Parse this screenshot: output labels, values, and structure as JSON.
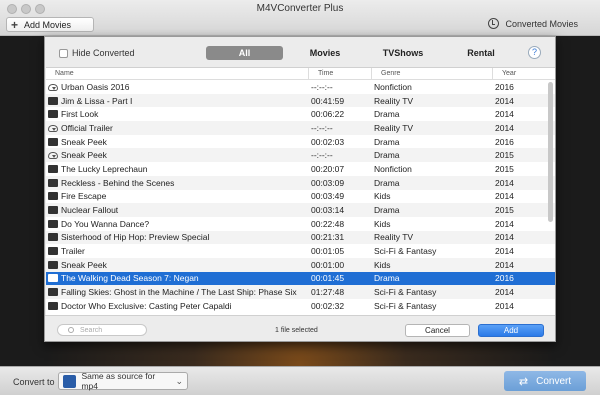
{
  "window": {
    "title": "M4VConverter Plus"
  },
  "toolbar": {
    "add_movies": "Add Movies",
    "converted_movies": "Converted Movies"
  },
  "dialog": {
    "hide_converted": "Hide Converted",
    "hide_converted_checked": false,
    "tabs": [
      {
        "label": "All",
        "active": true
      },
      {
        "label": "Movies",
        "active": false
      },
      {
        "label": "TVShows",
        "active": false
      },
      {
        "label": "Rental",
        "active": false
      }
    ],
    "help": "?",
    "columns": {
      "name": "Name",
      "time": "Time",
      "genre": "Genre",
      "year": "Year"
    },
    "rows": [
      {
        "icon": "cloud-download-icon",
        "name": "Urban Oasis 2016",
        "time": "--:--:--",
        "genre": "Nonfiction",
        "year": "2016"
      },
      {
        "icon": "film-icon",
        "name": "Jim & Lissa - Part I",
        "time": "00:41:59",
        "genre": "Reality TV",
        "year": "2014"
      },
      {
        "icon": "film-icon",
        "name": "First Look",
        "time": "00:06:22",
        "genre": "Drama",
        "year": "2014"
      },
      {
        "icon": "cloud-download-icon",
        "name": "Official Trailer",
        "time": "--:--:--",
        "genre": "Reality TV",
        "year": "2014"
      },
      {
        "icon": "film-icon",
        "name": "Sneak Peek",
        "time": "00:02:03",
        "genre": "Drama",
        "year": "2016"
      },
      {
        "icon": "cloud-download-icon",
        "name": "Sneak Peek",
        "time": "--:--:--",
        "genre": "Drama",
        "year": "2015"
      },
      {
        "icon": "film-icon",
        "name": "The Lucky Leprechaun",
        "time": "00:20:07",
        "genre": "Nonfiction",
        "year": "2015"
      },
      {
        "icon": "film-icon",
        "name": "Reckless - Behind the Scenes",
        "time": "00:03:09",
        "genre": "Drama",
        "year": "2014"
      },
      {
        "icon": "film-icon",
        "name": "Fire Escape",
        "time": "00:03:49",
        "genre": "Kids",
        "year": "2014"
      },
      {
        "icon": "film-icon",
        "name": "Nuclear Fallout",
        "time": "00:03:14",
        "genre": "Drama",
        "year": "2015"
      },
      {
        "icon": "film-icon",
        "name": "Do You Wanna Dance?",
        "time": "00:22:48",
        "genre": "Kids",
        "year": "2014"
      },
      {
        "icon": "film-icon",
        "name": "Sisterhood of Hip Hop: Preview Special",
        "time": "00:21:31",
        "genre": "Reality TV",
        "year": "2014"
      },
      {
        "icon": "film-icon",
        "name": "Trailer",
        "time": "00:01:05",
        "genre": "Sci-Fi & Fantasy",
        "year": "2014"
      },
      {
        "icon": "film-icon",
        "name": "Sneak Peek",
        "time": "00:01:00",
        "genre": "Kids",
        "year": "2014"
      },
      {
        "icon": "film-icon",
        "name": "The Walking Dead Season 7: Negan",
        "time": "00:01:45",
        "genre": "Drama",
        "year": "2016",
        "selected": true
      },
      {
        "icon": "film-icon",
        "name": "Falling Skies: Ghost in the Machine / The Last Ship: Phase Six",
        "time": "01:27:48",
        "genre": "Sci-Fi & Fantasy",
        "year": "2014"
      },
      {
        "icon": "film-icon",
        "name": "Doctor Who Exclusive: Casting Peter Capaldi",
        "time": "00:02:32",
        "genre": "Sci-Fi & Fantasy",
        "year": "2014"
      }
    ],
    "search_placeholder": "Search",
    "status": "1 file selected",
    "cancel": "Cancel",
    "add": "Add"
  },
  "bottom": {
    "convert_to": "Convert to",
    "format": "Same as source for mp4",
    "convert": "Convert"
  },
  "colors": {
    "accent": "#1f6ed4",
    "convert_button": "#7aa8dc"
  }
}
